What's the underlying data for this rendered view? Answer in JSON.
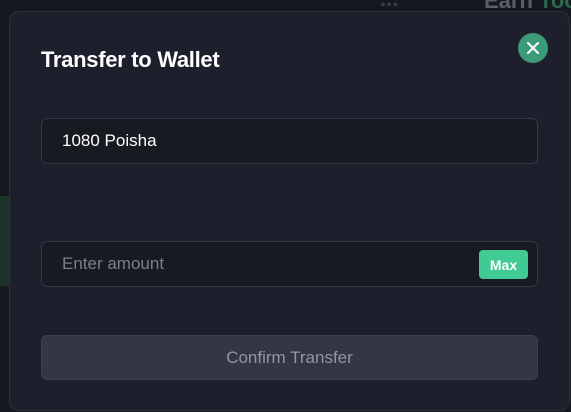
{
  "background": {
    "header_text": "Earn",
    "header_accent_text": "Too",
    "dots": "..."
  },
  "modal": {
    "title": "Transfer to Wallet",
    "close_icon": "close-icon",
    "balance_value": "1080 Poisha",
    "amount_placeholder": "Enter amount",
    "amount_value": "",
    "max_label": "Max",
    "confirm_label": "Confirm Transfer"
  },
  "colors": {
    "accent": "#3fcb93",
    "close_button": "#3c9a78",
    "modal_background": "#1d1f2c",
    "disabled_button": "#323645"
  }
}
